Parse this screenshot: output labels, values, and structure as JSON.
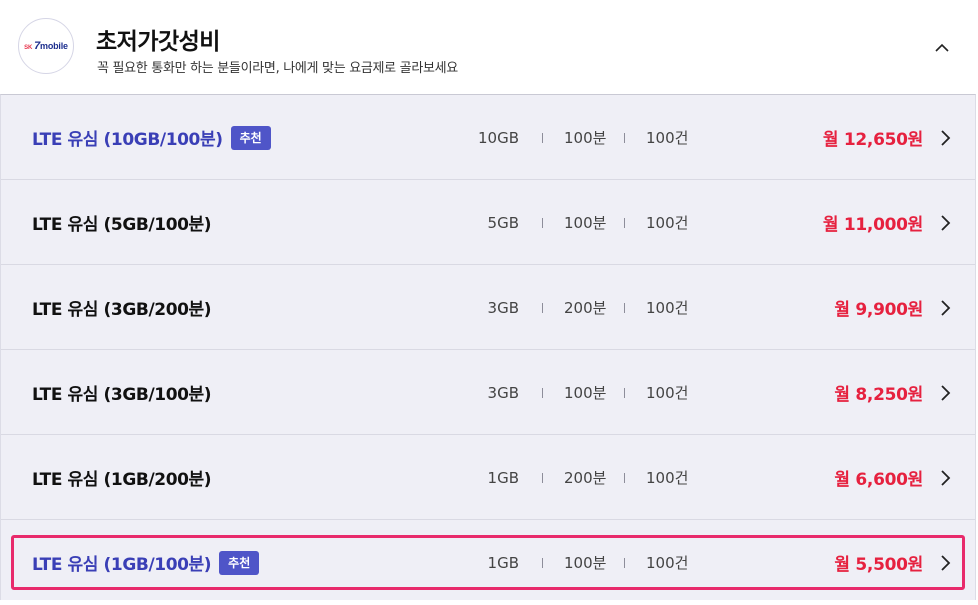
{
  "header": {
    "logo": {
      "sk": "SK",
      "seven": "7",
      "mobile": "mobile"
    },
    "title": "초저가갓성비",
    "subtitle": "꼭 필요한 통화만 하는 분들이라면, 나에게 맞는 요금제로 골라보세요",
    "collapse_icon": "chevron-up-icon"
  },
  "plans": [
    {
      "name": "LTE 유심 (10GB/100분)",
      "badge": "추천",
      "data": "10GB",
      "voice": "100분",
      "sms": "100건",
      "price": "월 12,650원"
    },
    {
      "name": "LTE 유심 (5GB/100분)",
      "badge": "",
      "data": "5GB",
      "voice": "100분",
      "sms": "100건",
      "price": "월 11,000원"
    },
    {
      "name": "LTE 유심 (3GB/200분)",
      "badge": "",
      "data": "3GB",
      "voice": "200분",
      "sms": "100건",
      "price": "월 9,900원"
    },
    {
      "name": "LTE 유심 (3GB/100분)",
      "badge": "",
      "data": "3GB",
      "voice": "100분",
      "sms": "100건",
      "price": "월 8,250원"
    },
    {
      "name": "LTE 유심 (1GB/200분)",
      "badge": "",
      "data": "1GB",
      "voice": "200분",
      "sms": "100건",
      "price": "월 6,600원"
    },
    {
      "name": "LTE 유심 (1GB/100분)",
      "badge": "추천",
      "data": "1GB",
      "voice": "100분",
      "sms": "100건",
      "price": "월 5,500원"
    }
  ],
  "colors": {
    "accent": "#4f55c8",
    "price": "#e6213f",
    "selection_outline": "#e82a6b",
    "list_bg": "#efeff6"
  },
  "row_icon": "chevron-right-icon"
}
